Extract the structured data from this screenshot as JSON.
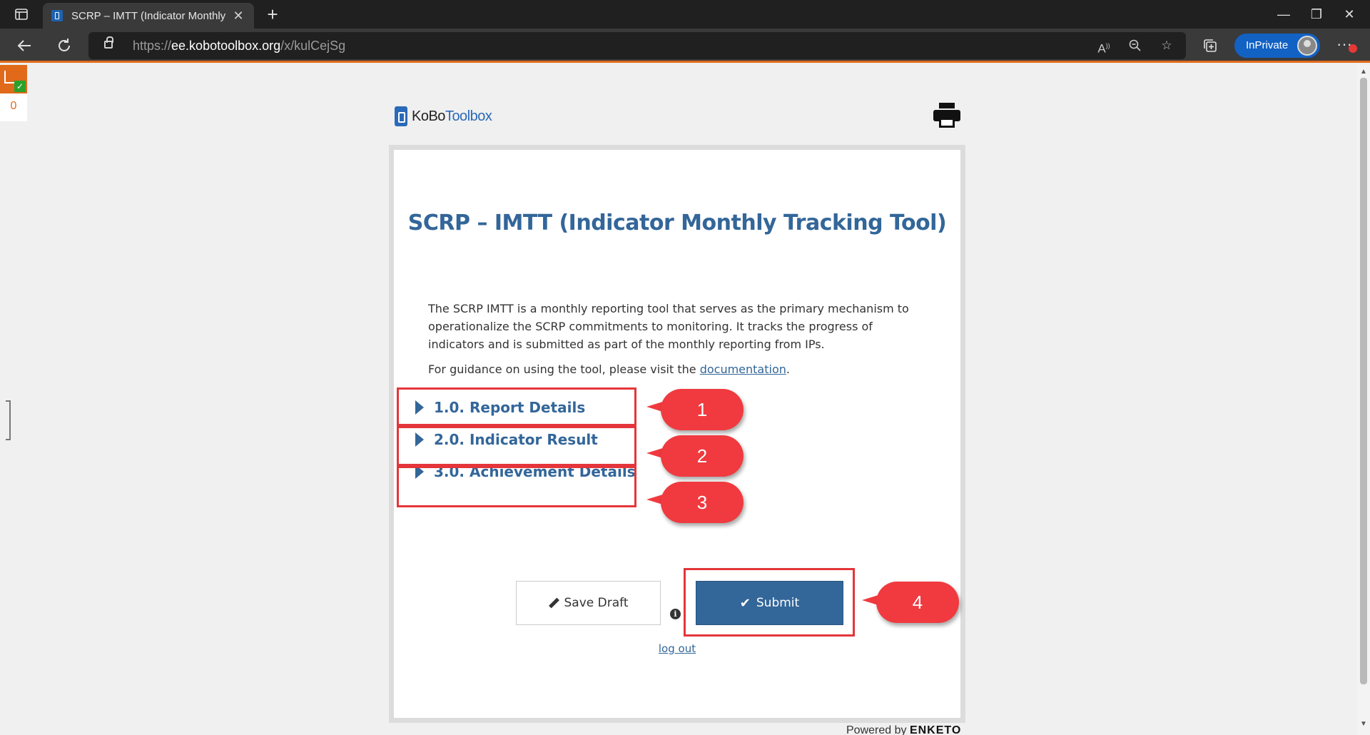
{
  "browser": {
    "tab_title": "SCRP – IMTT (Indicator Monthly",
    "tab_close": "✕",
    "new_tab": "+",
    "url_scheme": "https://",
    "url_host": "ee.kobotoolbox.org",
    "url_path": "/x/kulCejSg",
    "inprivate_label": "InPrivate",
    "window_controls": {
      "minimize": "—",
      "maximize": "❐",
      "close": "✕"
    }
  },
  "side_widget": {
    "count": "0"
  },
  "header": {
    "logo_part1": "KoBo",
    "logo_part2": "Toolbox"
  },
  "form": {
    "title": "SCRP – IMTT (Indicator Monthly Tracking Tool)",
    "intro": "The SCRP IMTT is a monthly reporting tool that serves as the primary mechanism to operationalize the SCRP commitments to monitoring. It tracks the progress of indicators and is submitted as part of the monthly reporting from IPs.",
    "guide_prefix": "For guidance on using the tool, please visit the ",
    "guide_link": "documentation",
    "guide_suffix": ".",
    "sections": [
      {
        "label": "1.0. Report Details"
      },
      {
        "label": "2.0. Indicator Result"
      },
      {
        "label": "3.0. Achievement Details"
      }
    ],
    "save_draft_label": "Save Draft",
    "info_glyph": "i",
    "submit_label": "Submit",
    "logout_label": "log out"
  },
  "footer": {
    "powered_by": "Powered by",
    "brand": "ENKETO"
  },
  "annotations": {
    "callouts": [
      "1",
      "2",
      "3",
      "4"
    ],
    "highlight_color": "#e4363a",
    "callout_color": "#f03a3f"
  },
  "icons": {
    "back": "back-arrow-icon",
    "reload": "reload-icon",
    "lock": "lock-icon",
    "print": "printer-icon",
    "pencil": "pencil-icon",
    "check": "check-icon",
    "info": "info-icon"
  },
  "colors": {
    "brand_blue": "#336699",
    "chrome_dark": "#202020",
    "accent_orange": "#e06a1a"
  }
}
